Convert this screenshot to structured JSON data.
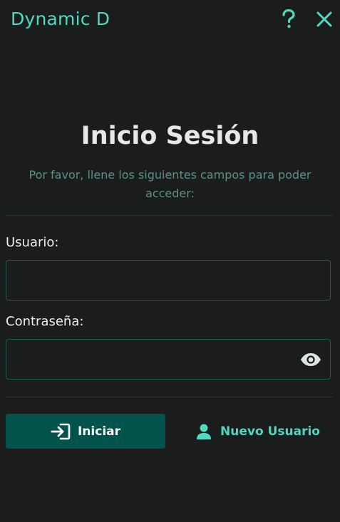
{
  "app": {
    "title": "Dynamic D"
  },
  "colors": {
    "background": "#1b1d1d",
    "accent": "#4fd8c2",
    "primary_button": "#02534b",
    "muted_text": "#5d8f8a",
    "input_border": "#1f5a53"
  },
  "titlebar": {
    "help_icon": "question-mark-icon",
    "close_icon": "close-icon"
  },
  "login": {
    "heading": "Inicio Sesión",
    "subtitle": "Por favor, llene los siguientes campos para poder acceder:",
    "username_label": "Usuario:",
    "username_value": "",
    "password_label": "Contraseña:",
    "password_value": "",
    "show_password_icon": "eye-icon"
  },
  "actions": {
    "login_label": "Iniciar",
    "login_icon": "login-arrow-icon",
    "new_user_label": "Nuevo Usuario",
    "new_user_icon": "user-icon"
  }
}
